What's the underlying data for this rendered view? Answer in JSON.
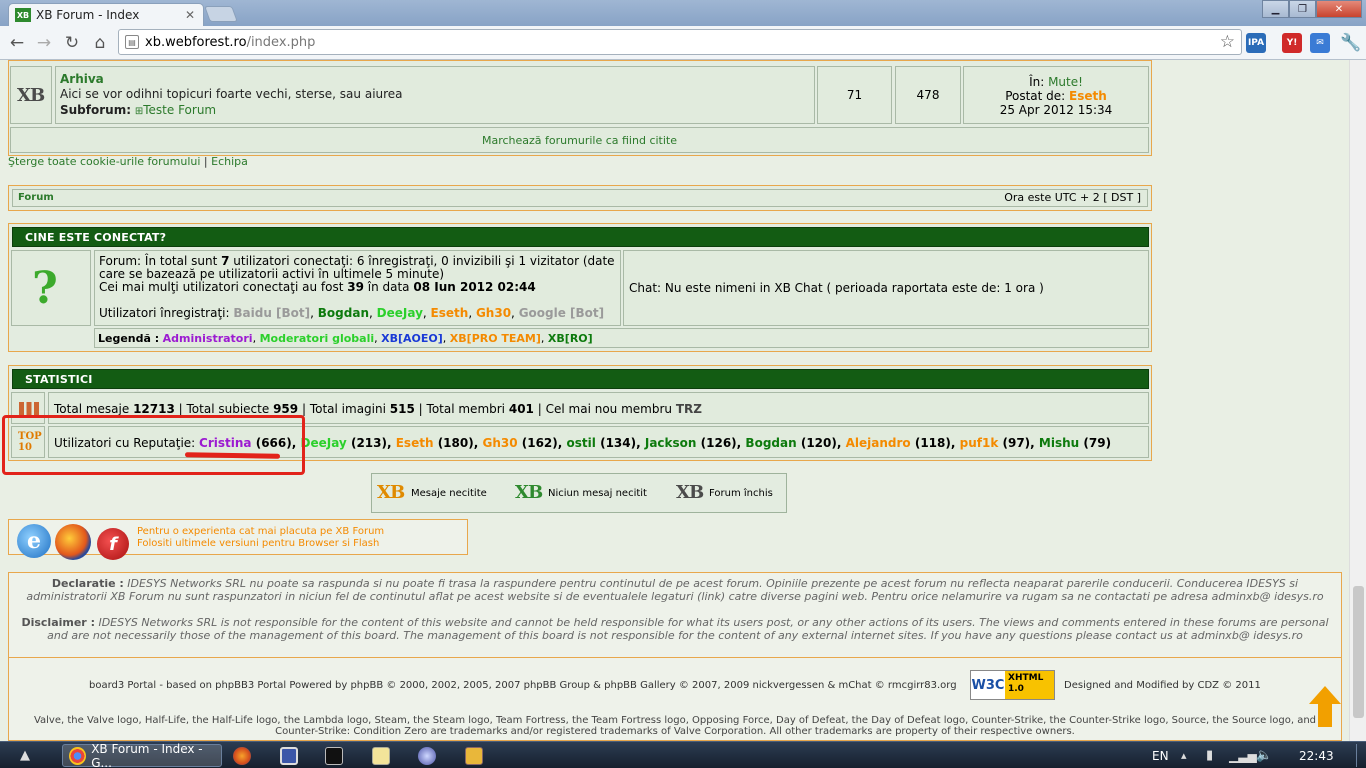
{
  "browser": {
    "tab_title": "XB Forum - Index",
    "tab_favicon": "XB",
    "url_host": "xb.webforest.ro",
    "url_path": "/index.php",
    "window_buttons": [
      "▁",
      "❐",
      "✕"
    ]
  },
  "forum_row": {
    "title": "Arhiva",
    "description": "Aici se vor odihni topicuri foarte vechi, sterse, sau aiurea",
    "subforum_label": "Subforum:",
    "subforum_link": "Teste Forum",
    "topics": "71",
    "posts": "478",
    "last_in_label": "În:",
    "last_in_value": "Mute!",
    "last_posted_label": "Postat de:",
    "last_posted_value": "Eseth",
    "last_date": "25 Apr 2012 15:34"
  },
  "mark_read": "Marchează forumurile ca fiind citite",
  "footer_links": {
    "delete_cookies": "Şterge toate cookie-urile forumului",
    "sep": "|",
    "team": "Echipa"
  },
  "forum_bar": {
    "left": "Forum",
    "right": "Ora este UTC + 2 [ DST ]"
  },
  "who_online": {
    "header": "CINE ESTE CONECTAT?",
    "line1_a": "Forum: În total sunt ",
    "line1_b": "7",
    "line1_c": " utilizatori conectaţi: 6 înregistraţi, 0 invizibili şi 1 vizitator (date care se bazează pe utilizatorii activi în ultimele 5 minute)",
    "line2_a": "Cei mai mulţi utilizatori conectaţi au fost ",
    "line2_b": "39",
    "line2_c": " în data ",
    "line2_d": "08 Iun 2012 02:44",
    "registered_label": "Utilizatori înregistraţi:",
    "users": [
      {
        "name": "Baidu [Bot]",
        "sep": ", "
      },
      {
        "name": "Bogdan",
        "sep": ", "
      },
      {
        "name": "DeeJay",
        "sep": ", "
      },
      {
        "name": "Eseth",
        "sep": ", "
      },
      {
        "name": "Gh30",
        "sep": ", "
      },
      {
        "name": "Google [Bot]",
        "sep": ""
      }
    ],
    "chat": "Chat: Nu este nimeni in XB Chat ( perioada raportata este de: 1 ora )",
    "legend_label": "Legendă :",
    "legend": [
      "Administratori",
      "Moderatori globali",
      "XB[AOEO]",
      "XB[PRO TEAM]",
      "XB[RO]"
    ]
  },
  "stats": {
    "header": "STATISTICI",
    "posts_label": "Total mesaje",
    "posts": "12713",
    "topics_label": "Total subiecte",
    "topics": "959",
    "images_label": "Total imagini",
    "images": "515",
    "members_label": "Total membri",
    "members": "401",
    "newest_label": "Cel mai nou membru",
    "newest": "TRZ",
    "sep": "|",
    "reputation_label": "Utilizatori cu Reputaţie:",
    "reputation": [
      {
        "name": "Cristina",
        "score": "(666)"
      },
      {
        "name": "DeeJay",
        "score": "(213)"
      },
      {
        "name": "Eseth",
        "score": "(180)"
      },
      {
        "name": "Gh30",
        "score": "(162)"
      },
      {
        "name": "ostil",
        "score": "(134)"
      },
      {
        "name": "Jackson",
        "score": "(126)"
      },
      {
        "name": "Bogdan",
        "score": "(120)"
      },
      {
        "name": "Alejandro",
        "score": "(118)"
      },
      {
        "name": "puf1k",
        "score": "(97)"
      },
      {
        "name": "Mishu",
        "score": "(79)"
      }
    ]
  },
  "icon_legend": {
    "unread": "Mesaje necitite",
    "no_unread": "Niciun mesaj necitit",
    "locked": "Forum închis"
  },
  "browser_note": {
    "line1": "Pentru o experienta cat mai placuta pe XB Forum",
    "line2": "Folositi ultimele versiuni pentru Browser si Flash"
  },
  "declaratie": {
    "label": "Declaratie :",
    "text": "IDESYS Networks SRL nu poate sa raspunda si nu poate fi trasa la raspundere pentru continutul de pe acest forum. Opiniile prezente pe acest forum nu reflecta neaparat parerile conducerii. Conducerea IDESYS si administratorii XB Forum nu sunt raspunzatori in niciun fel de continutul aflat pe acest website si de eventualele legaturi (link) catre diverse pagini web. Pentru orice nelamurire va rugam sa ne contactati pe adresa adminxb@ idesys.ro"
  },
  "disclaimer": {
    "label": "Disclaimer :",
    "text": "IDESYS Networks SRL is not responsible for the content of this website and cannot be held responsible for what its users post, or any other actions of its users. The views and comments entered in these forums are personal and are not necessarily those of the management of this board. The management of this board is not responsible for the content of any external internet sites. If you have any questions please contact us at adminxb@ idesys.ro"
  },
  "credits": {
    "left": "board3 Portal - based on phpBB3 Portal Powered by phpBB © 2000, 2002, 2005, 2007 phpBB Group & phpBB Gallery © 2007, 2009 nickvergessen & mChat © rmcgirr83.org",
    "badge_w3c": "W3C",
    "badge_xhtml": "XHTML",
    "badge_ver": "1.0",
    "right": "Designed and Modified by CDZ © 2011"
  },
  "valve": "Valve, the Valve logo, Half-Life, the Half-Life logo, the Lambda logo, Steam, the Steam logo, Team Fortress, the Team Fortress logo, Opposing Force, Day of Defeat, the Day of Defeat logo, Counter-Strike, the Counter-Strike logo, Source, the Source logo, and Counter-Strike: Condition Zero are trademarks and/or registered trademarks of Valve Corporation. All other trademarks are property of their respective owners.",
  "taskbar": {
    "app_label": "XB Forum - Index - G...",
    "lang": "EN",
    "time": "22:43"
  }
}
